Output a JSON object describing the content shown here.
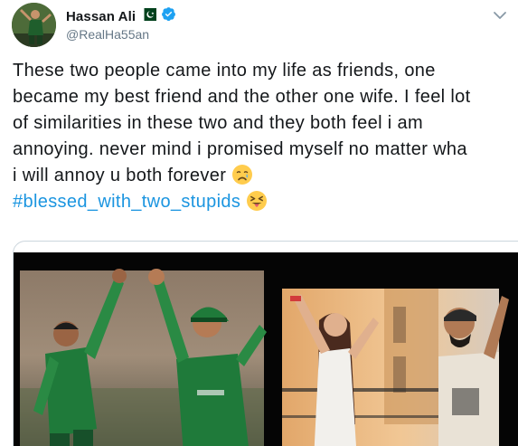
{
  "user": {
    "display_name": "Hassan Ali",
    "handle": "@RealHa55an",
    "avatar_icon": "profile-photo-avatar",
    "flag_icon": "pakistan-flag-icon",
    "verified_icon": "verified-badge-icon",
    "verified_color": "#1da1f2"
  },
  "tweet": {
    "lines": [
      "These two people came into my life as friends, one",
      "became my best friend and the other one wife. I feel lot",
      "of similarities in these two and they both feel i am",
      "annoying. never mind i promised myself no matter wha",
      "i will annoy u both forever"
    ],
    "emoji_1": "crying-face-emoji",
    "hashtag": "#blessed_with_two_stupids",
    "emoji_2": "squinting-tongue-face-emoji",
    "hashtag_color": "#1b95e0"
  },
  "media": {
    "type": "photo-collage",
    "icon": "cricket-celebration-photos"
  },
  "menu": {
    "icon": "chevron-down-icon"
  }
}
